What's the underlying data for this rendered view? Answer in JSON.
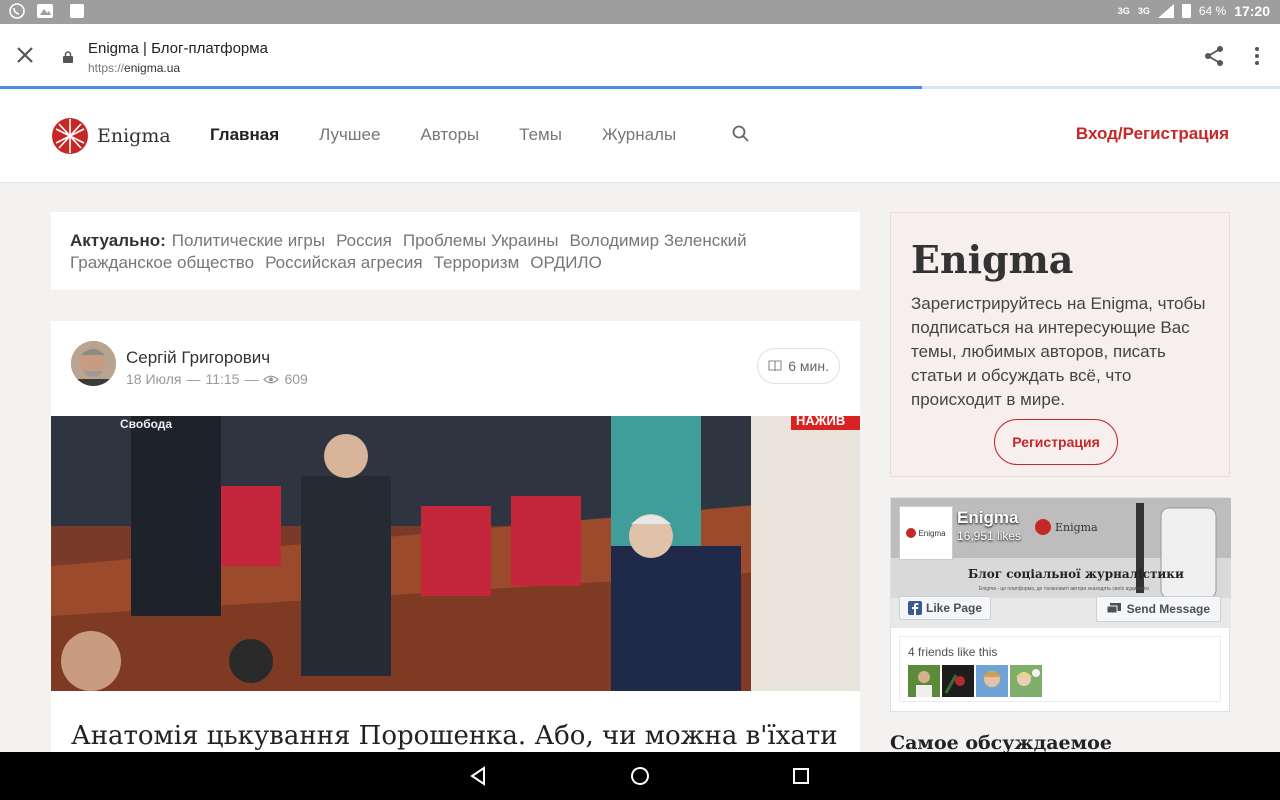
{
  "status_bar": {
    "network_label": "3G",
    "network_label_2": "3G",
    "battery": "64 %",
    "time": "17:20"
  },
  "browser": {
    "page_title": "Enigma | Блог-платформа",
    "url_protocol": "https://",
    "url_host": "enigma.ua",
    "load_progress": 0.72
  },
  "site": {
    "logo_text": "Enigma",
    "nav": [
      {
        "label": "Главная",
        "active": true
      },
      {
        "label": "Лучшее",
        "active": false
      },
      {
        "label": "Авторы",
        "active": false
      },
      {
        "label": "Темы",
        "active": false
      },
      {
        "label": "Журналы",
        "active": false
      }
    ],
    "login_label": "Вход/Регистрация",
    "accent_color": "#c62828"
  },
  "topics": {
    "label": "Актуально:",
    "items": [
      "Политические игры",
      "Россия",
      "Проблемы Украины",
      "Володимир Зеленский",
      "Гражданское общество",
      "Российская агресия",
      "Терроризм",
      "ОРДИЛО"
    ]
  },
  "post": {
    "author": "Сергій Григорович",
    "date": "18 Июля",
    "time": "11:15",
    "views": "609",
    "read_time": "6 мин.",
    "image_overlay_left": "Свобода",
    "image_overlay_right": "НАЖИВ",
    "title": "Анатомія цькування Порошенка. Або, чи можна в'їхати"
  },
  "sidebar": {
    "register_card": {
      "heading": "Enigma",
      "text": "Зарегистрируйтесь на Enigma, чтобы подписаться на интересующие Вас темы, любимых авторов, писать статьи и обсуждать всё, что происходит в мире.",
      "button": "Регистрация"
    },
    "facebook": {
      "page_name": "Enigma",
      "likes": "16,951 likes",
      "thumb_text": "Enigma",
      "cover_logo": "Enigma",
      "cover_tagline": "Блог соціальної журналістики",
      "cover_subtext": "Enigma - це платформа, де талановиті автори знаходять своїх аудиторію",
      "like_button": "Like Page",
      "send_button": "Send Message",
      "friends_text": "4 friends like this"
    },
    "most_discussed": "Самое обсуждаемое"
  }
}
